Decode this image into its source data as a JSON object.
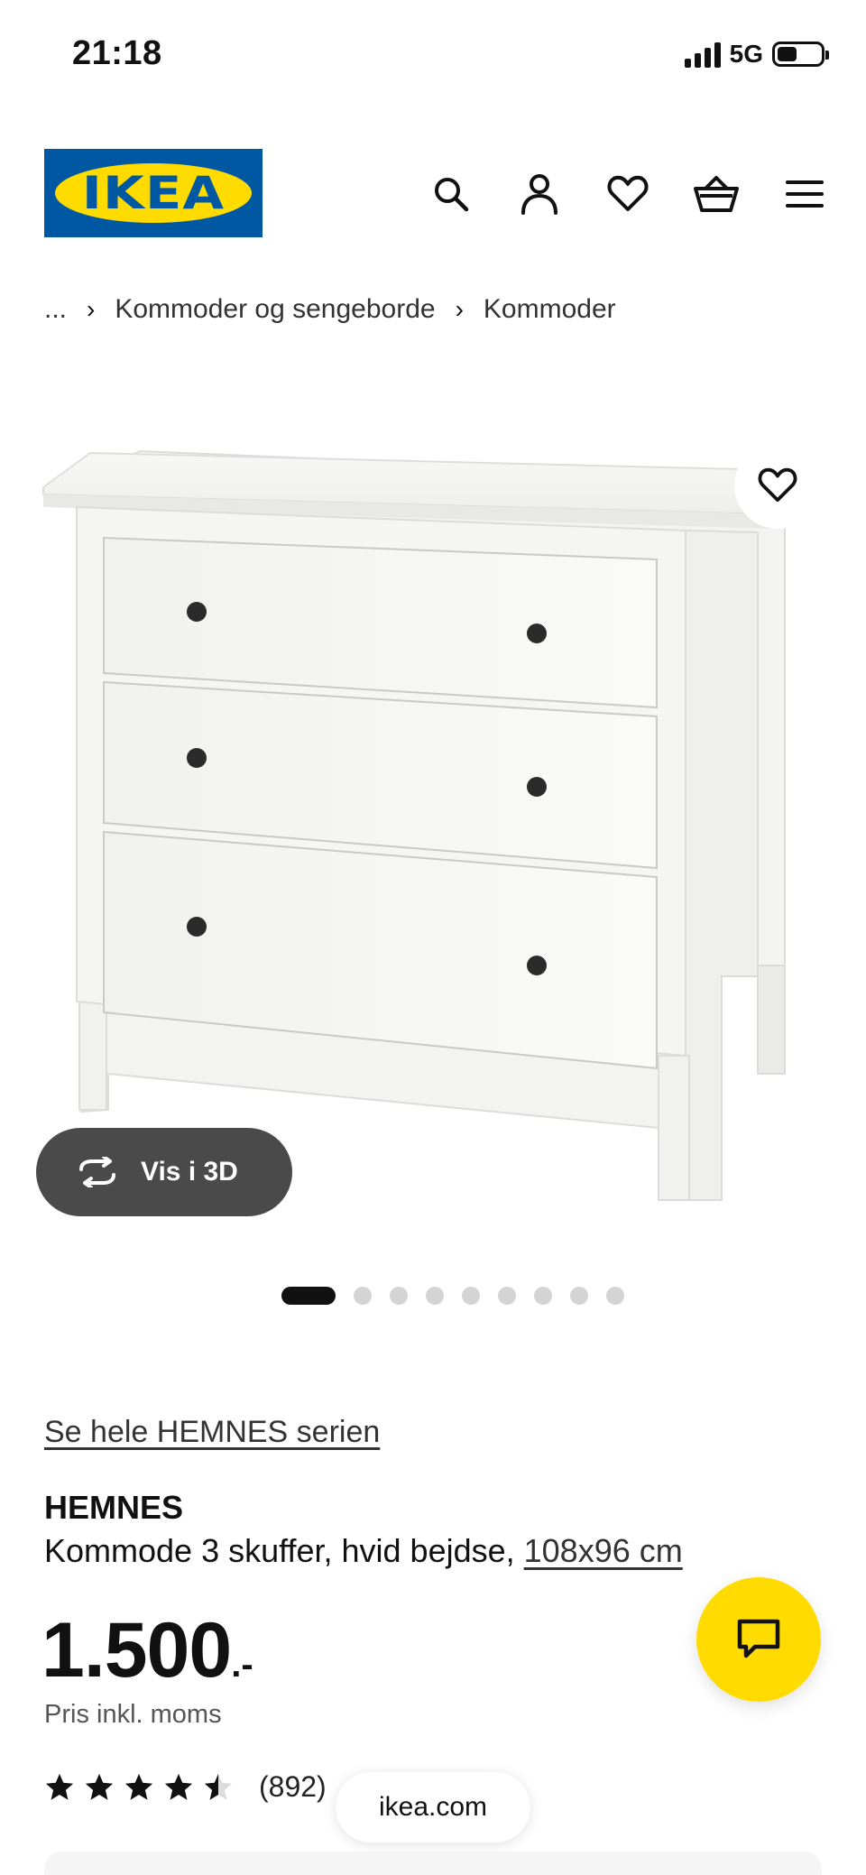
{
  "status_bar": {
    "time": "21:18",
    "network": "5G",
    "battery_level": 0.45
  },
  "header": {
    "logo_text": "IKEA",
    "icons": [
      "search-icon",
      "account-icon",
      "heart-icon",
      "basket-icon",
      "menu-icon"
    ],
    "colors": {
      "logo_blue": "#0058a3",
      "logo_yellow": "#ffdb00"
    }
  },
  "breadcrumb": {
    "items": [
      "...",
      "Kommoder og sengeborde",
      "Kommoder"
    ],
    "separator": "›"
  },
  "gallery": {
    "view_3d_label": "Vis i 3D",
    "total_images": 9,
    "active_index": 0
  },
  "product": {
    "series_link": "Se hele HEMNES serien",
    "name": "HEMNES",
    "description": "Kommode 3 skuffer, hvid bejdse, ",
    "dimensions": "108x96 cm",
    "price_amount": "1.500",
    "price_suffix": ".-",
    "price_note": "Pris inkl. moms",
    "rating_value": 4.5,
    "rating_max": 5,
    "review_count": "(892)"
  },
  "browser": {
    "url": "ikea.com"
  },
  "colors": {
    "chat_button": "#ffdb00",
    "vis3d_bg": "#4a4a4a"
  }
}
